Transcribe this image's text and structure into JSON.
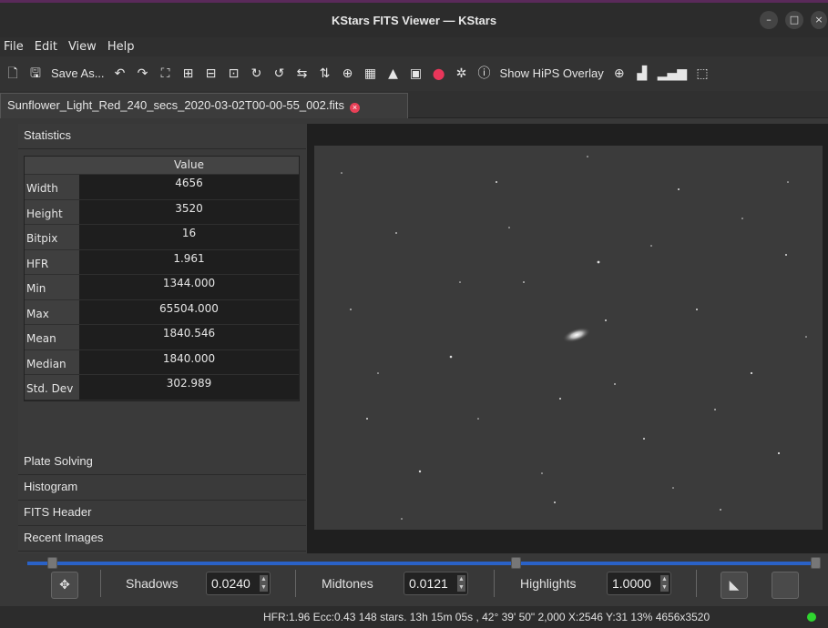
{
  "window": {
    "title": "KStars FITS Viewer — KStars"
  },
  "menu": [
    "File",
    "Edit",
    "View",
    "Help"
  ],
  "toolbar": {
    "save_as": "Save As...",
    "hips": "Show HiPS Overlay"
  },
  "tab": {
    "label": "Sunflower_Light_Red_240_secs_2020-03-02T00-00-55_002.fits"
  },
  "panel": {
    "statistics": "Statistics",
    "value_header": "Value",
    "rows": [
      {
        "k": "Width",
        "v": "4656"
      },
      {
        "k": "Height",
        "v": "3520"
      },
      {
        "k": "Bitpix",
        "v": "16"
      },
      {
        "k": "HFR",
        "v": "1.961"
      },
      {
        "k": "Min",
        "v": "1344.000"
      },
      {
        "k": "Max",
        "v": "65504.000"
      },
      {
        "k": "Mean",
        "v": "1840.546"
      },
      {
        "k": "Median",
        "v": "1840.000"
      },
      {
        "k": "Std. Dev",
        "v": "302.989"
      }
    ],
    "plate_solving": "Plate Solving",
    "histogram": "Histogram",
    "fits_header": "FITS Header",
    "recent_images": "Recent Images"
  },
  "controls": {
    "shadows_label": "Shadows",
    "shadows_value": "0.0240",
    "midtones_label": "Midtones",
    "midtones_value": "0.0121",
    "highlights_label": "Highlights",
    "highlights_value": "1.0000"
  },
  "status": {
    "text": "HFR:1.96 Ecc:0.43 148 stars.  13h 15m 05s ,  42° 39' 50\"  2,000    X:2546 Y:31    13%  4656x3520"
  }
}
